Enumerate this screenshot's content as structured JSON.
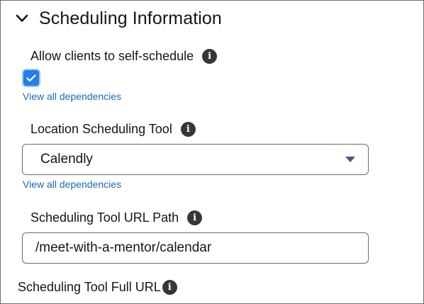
{
  "section": {
    "title": "Scheduling Information",
    "expanded": true,
    "chevron_icon": "chevron-down-icon"
  },
  "self_schedule": {
    "label": "Allow clients to self-schedule",
    "checked": true,
    "link": "View all dependencies",
    "info_icon": "info-icon"
  },
  "scheduling_tool": {
    "label": "Location Scheduling Tool",
    "selected": "Calendly",
    "link": "View all dependencies",
    "info_icon": "info-icon"
  },
  "url_path": {
    "label": "Scheduling Tool URL Path",
    "value": "/meet-with-a-mentor/calendar",
    "info_icon": "info-icon"
  },
  "full_url": {
    "label": "Scheduling Tool Full URL",
    "info_icon": "info-icon"
  },
  "colors": {
    "checkbox_fill": "#227fe8",
    "link": "#1a6bb4",
    "info_icon_bg": "#3a3631"
  }
}
